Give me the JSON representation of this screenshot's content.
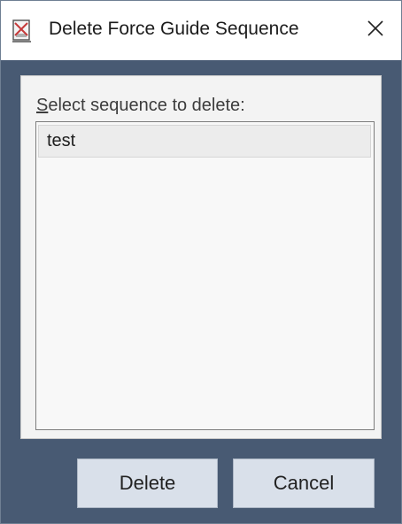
{
  "window": {
    "title": "Delete Force Guide Sequence",
    "icon": "delete-sequence-icon",
    "close_icon": "close-icon"
  },
  "panel": {
    "label_mnemonic": "S",
    "label_rest": "elect sequence to delete:",
    "sequences": [
      "test"
    ]
  },
  "buttons": {
    "delete_label": "Delete",
    "cancel_label": "Cancel"
  },
  "colors": {
    "window_background": "#485a73",
    "panel_background": "#f3f3f3",
    "button_background": "#d9e0ea",
    "selected_item": "#ececec"
  }
}
